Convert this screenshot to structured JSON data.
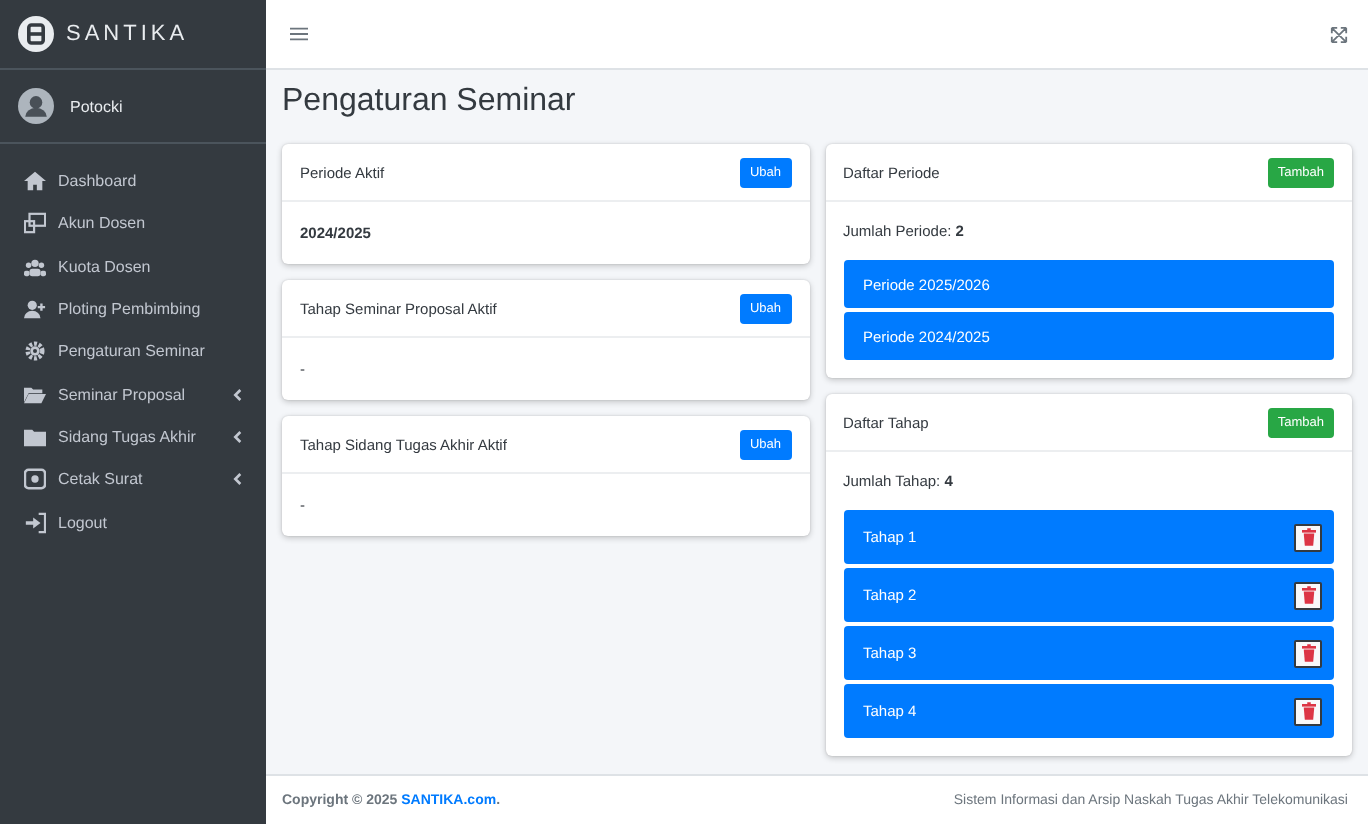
{
  "brand": {
    "name": "SANTIKA"
  },
  "user": {
    "name": "Potocki"
  },
  "sidebar": {
    "items": [
      {
        "label": "Dashboard",
        "selected": false,
        "has_submenu": false
      },
      {
        "label": "Akun Dosen",
        "selected": false,
        "has_submenu": false
      },
      {
        "label": "Kuota Dosen",
        "selected": false,
        "has_submenu": false
      },
      {
        "label": "Ploting Pembimbing",
        "selected": false,
        "has_submenu": false
      },
      {
        "label": "Pengaturan Seminar",
        "selected": false,
        "has_submenu": false
      },
      {
        "label": "Seminar Proposal",
        "selected": false,
        "has_submenu": true
      },
      {
        "label": "Sidang Tugas Akhir",
        "selected": false,
        "has_submenu": true
      },
      {
        "label": "Cetak Surat",
        "selected": false,
        "has_submenu": true
      },
      {
        "label": "Logout",
        "selected": false,
        "has_submenu": false
      }
    ]
  },
  "page_title": "Pengaturan Seminar",
  "settings_cards": [
    {
      "title": "Periode Aktif",
      "button": "Ubah",
      "value": "2024/2025",
      "bold": true
    },
    {
      "title": "Tahap Seminar Proposal Aktif",
      "button": "Ubah",
      "value": "-",
      "bold": false
    },
    {
      "title": "Tahap Sidang Tugas Akhir Aktif",
      "button": "Ubah",
      "value": "-",
      "bold": false
    }
  ],
  "list_cards": [
    {
      "title": "Daftar Periode",
      "button": "Tambah",
      "count_label": "Jumlah Periode: ",
      "count": "2",
      "deletable": false,
      "items": [
        "Periode 2025/2026",
        "Periode 2024/2025"
      ]
    },
    {
      "title": "Daftar Tahap",
      "button": "Tambah",
      "count_label": "Jumlah Tahap: ",
      "count": "4",
      "deletable": true,
      "items": [
        "Tahap 1",
        "Tahap 2",
        "Tahap 3",
        "Tahap 4"
      ]
    }
  ],
  "footer": {
    "copyright": "Copyright © 2025 ",
    "link": "SANTIKA.com",
    "end": ".",
    "right": "Sistem Informasi dan Arsip Naskah Tugas Akhir Telekomunikasi"
  }
}
